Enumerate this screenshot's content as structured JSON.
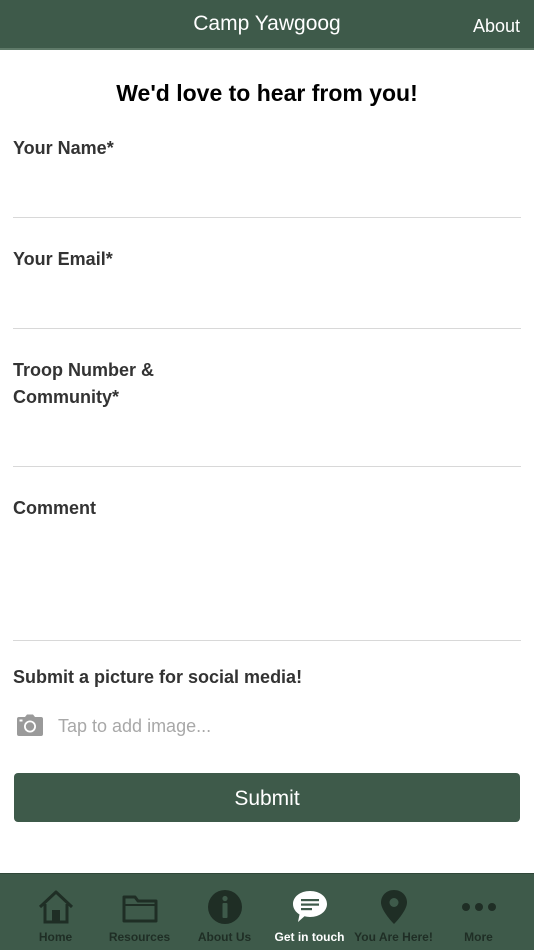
{
  "header": {
    "title": "Camp Yawgoog",
    "about_label": "About"
  },
  "form": {
    "heading": "We'd love to hear from you!",
    "name_label": "Your Name*",
    "email_label": "Your Email*",
    "troop_label_line1": "Troop Number &",
    "troop_label_line2": "Community*",
    "comment_label": "Comment",
    "picture_label": "Submit a picture for social media!",
    "image_placeholder": "Tap to add image...",
    "submit_label": "Submit"
  },
  "tabbar": {
    "items": [
      {
        "label": "Home",
        "icon": "home-icon"
      },
      {
        "label": "Resources",
        "icon": "folder-icon"
      },
      {
        "label": "About Us",
        "icon": "info-icon"
      },
      {
        "label": "Get in touch",
        "icon": "chat-icon",
        "active": true
      },
      {
        "label": "You Are Here!",
        "icon": "map-pin-icon"
      },
      {
        "label": "More",
        "icon": "more-icon"
      }
    ]
  },
  "colors": {
    "brand_green": "#3e5a4a",
    "tab_inactive": "#1f2e25",
    "tab_active": "#ffffff"
  }
}
